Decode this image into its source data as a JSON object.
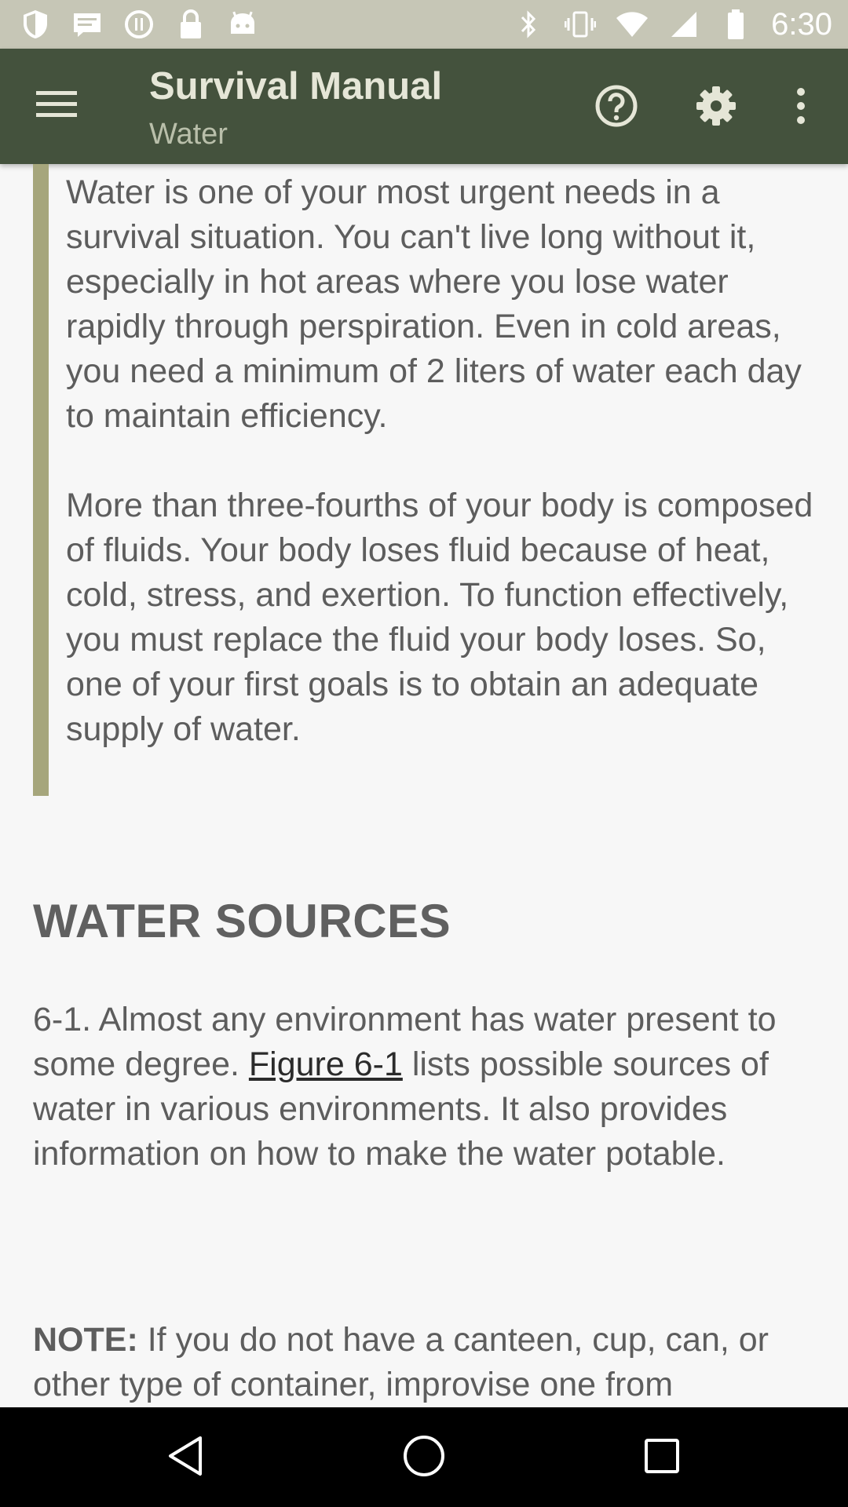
{
  "status_bar": {
    "time": "6:30",
    "left_icons": [
      "shield-icon",
      "message-icon",
      "sync-icon",
      "lock-icon",
      "android-icon"
    ],
    "right_icons": [
      "bluetooth-icon",
      "vibrate-icon",
      "wifi-icon",
      "signal-icon",
      "battery-icon"
    ]
  },
  "app_bar": {
    "title": "Survival Manual",
    "subtitle": "Water",
    "icons": [
      "menu-icon",
      "help-icon",
      "settings-icon",
      "more-vert-icon"
    ],
    "color": "#44523d"
  },
  "content": {
    "quote_paragraphs": [
      "Water is one of your most urgent needs in a survival situation. You can't live long without it, especially in hot areas where you lose water rapidly through perspiration. Even in cold areas, you need a minimum of 2 liters of water each day to maintain efficiency.",
      "More than three-fourths of your body is composed of fluids. Your body loses fluid because of heat, cold, stress, and exertion. To function effectively, you must replace the fluid your body loses. So, one of your first goals is to obtain an adequate supply of water."
    ],
    "heading": "WATER SOURCES",
    "para1_before": "6-1. Almost any environment has water present to some degree. ",
    "para1_link": "Figure 6-1",
    "para1_after": " lists possible sources of water in various environments. It also provides information on how to make the water potable.",
    "note_label": "NOTE:",
    "note_text": " If you do not have a canteen, cup, can, or other type of container, improvise one from"
  },
  "nav_bar": {
    "icons": [
      "back-icon",
      "home-icon",
      "recents-icon"
    ]
  }
}
